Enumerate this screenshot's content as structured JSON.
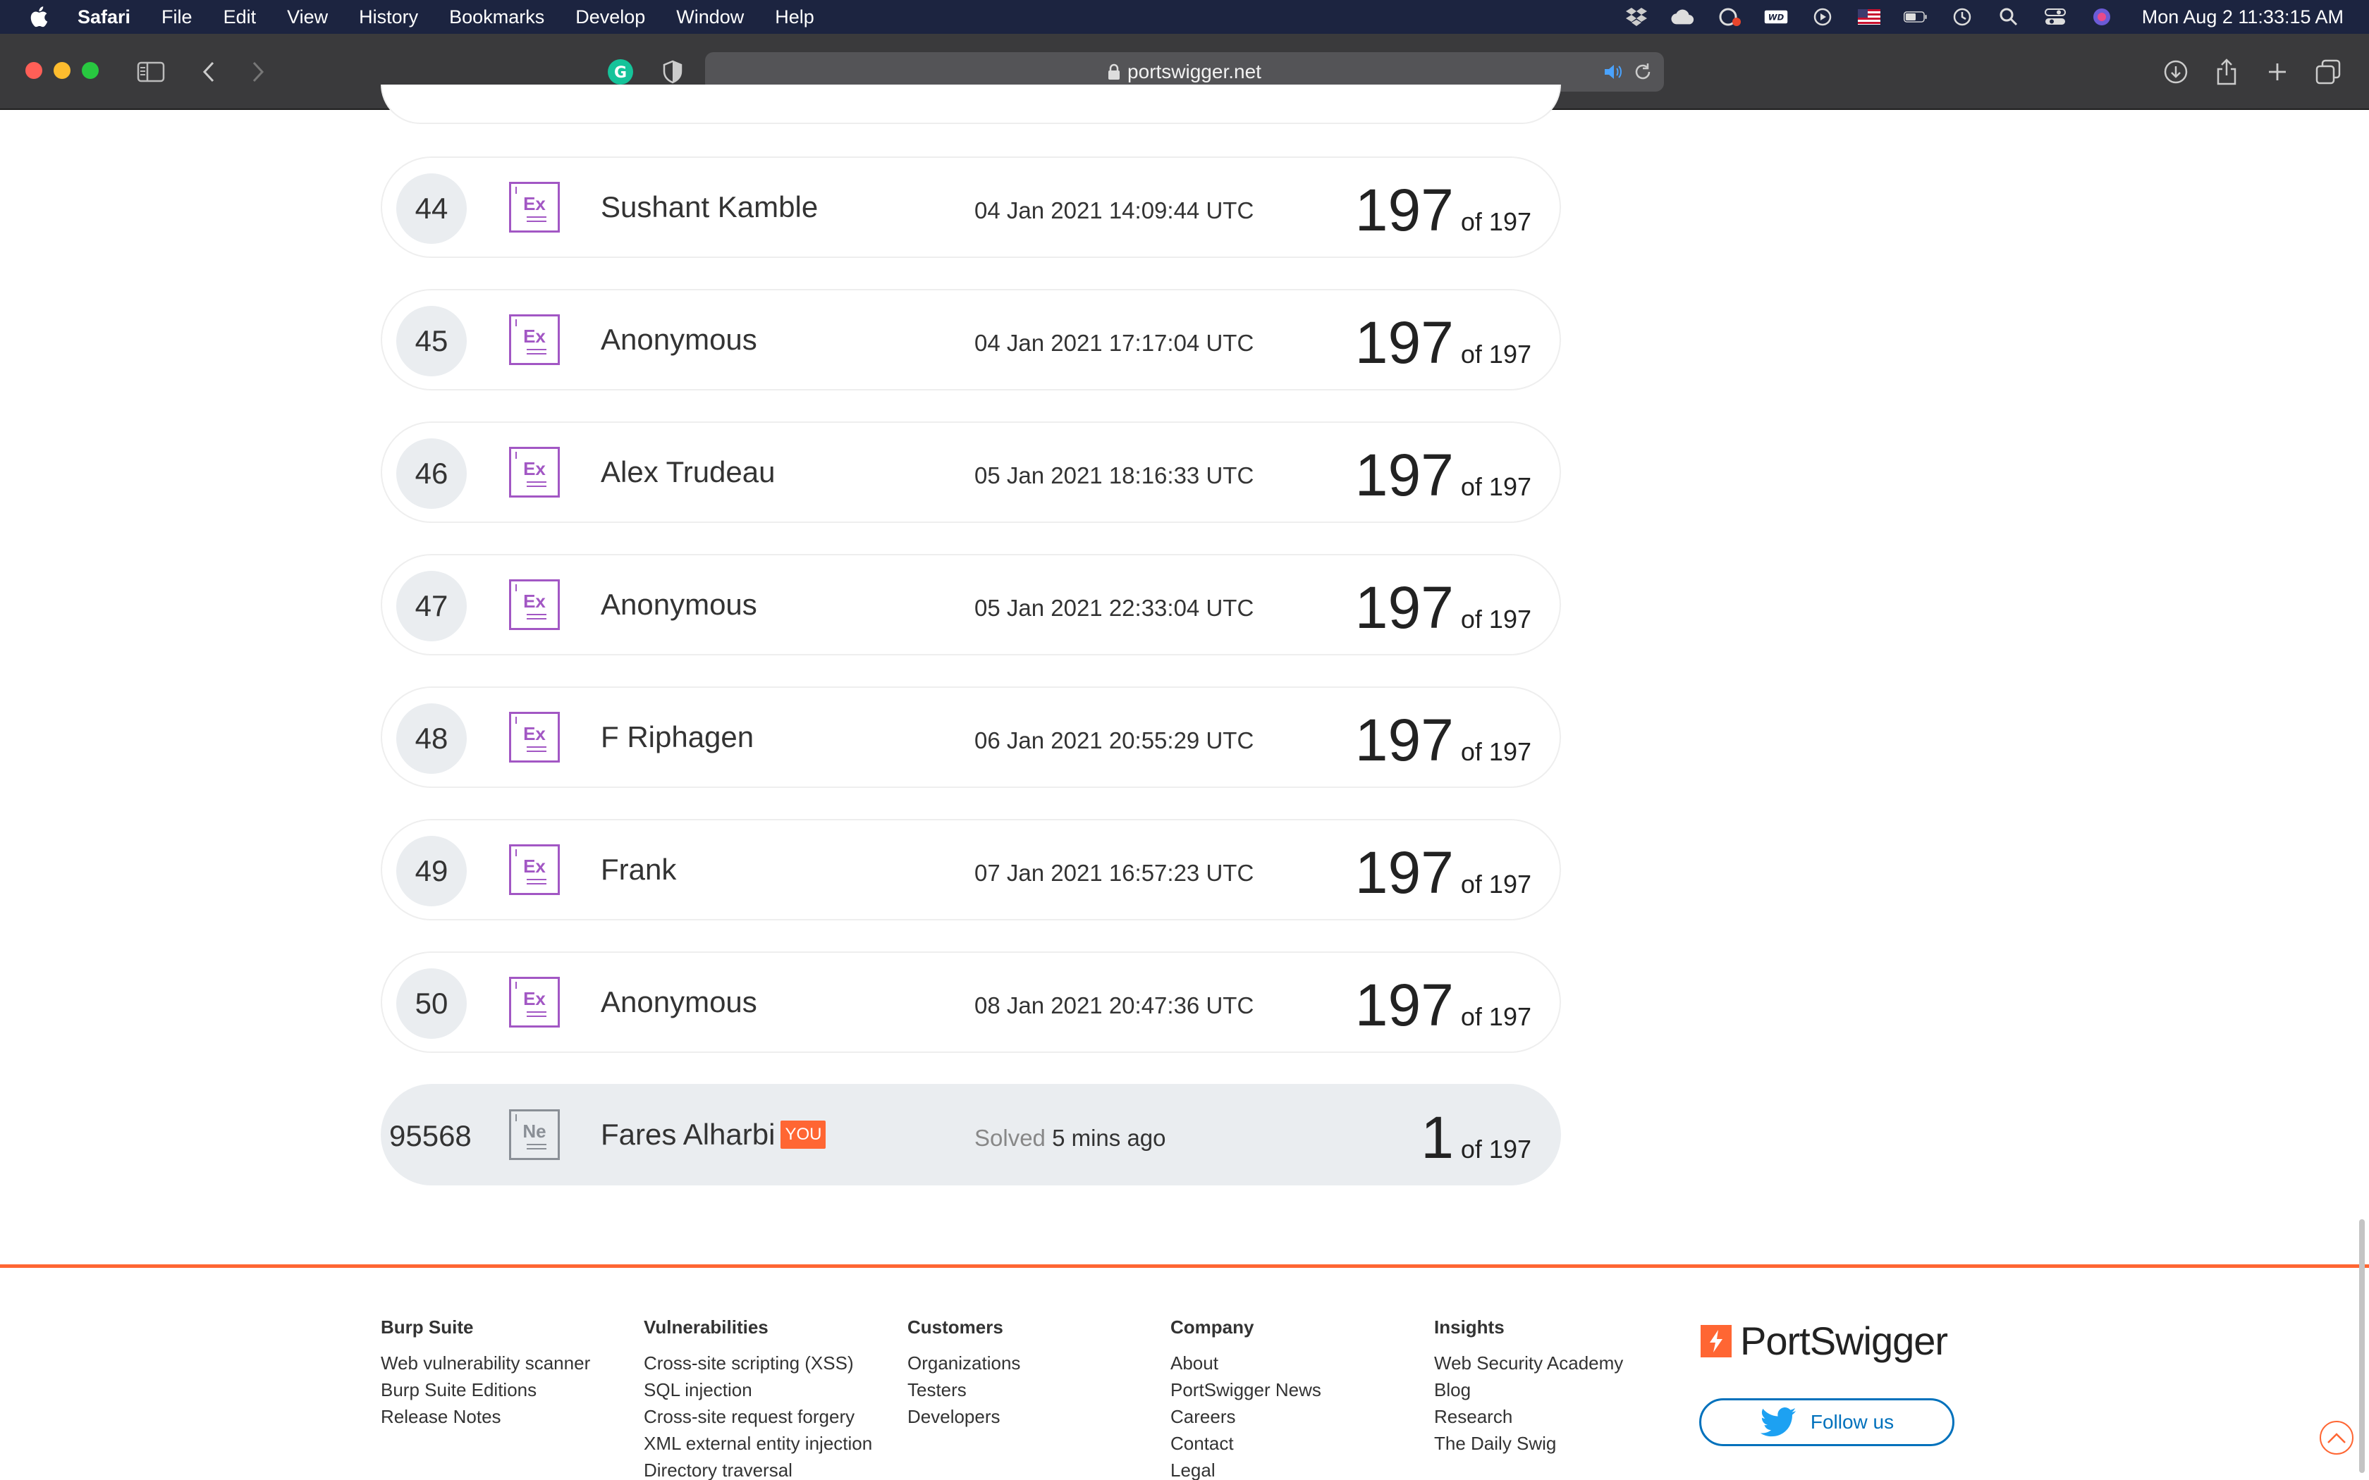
{
  "menubar": {
    "app": "Safari",
    "items": [
      "File",
      "Edit",
      "View",
      "History",
      "Bookmarks",
      "Develop",
      "Window",
      "Help"
    ],
    "clock": "Mon Aug 2  11:33:15 AM"
  },
  "toolbar": {
    "url": "portswigger.net"
  },
  "leaderboard": {
    "rows": [
      {
        "rank": "44",
        "badge": "Ex",
        "name": "Sushant Kamble",
        "date": "04 Jan 2021 14:09:44 UTC",
        "score": "197",
        "of": "of 197"
      },
      {
        "rank": "45",
        "badge": "Ex",
        "name": "Anonymous",
        "date": "04 Jan 2021 17:17:04 UTC",
        "score": "197",
        "of": "of 197"
      },
      {
        "rank": "46",
        "badge": "Ex",
        "name": "Alex Trudeau",
        "date": "05 Jan 2021 18:16:33 UTC",
        "score": "197",
        "of": "of 197"
      },
      {
        "rank": "47",
        "badge": "Ex",
        "name": "Anonymous",
        "date": "05 Jan 2021 22:33:04 UTC",
        "score": "197",
        "of": "of 197"
      },
      {
        "rank": "48",
        "badge": "Ex",
        "name": "F Riphagen",
        "date": "06 Jan 2021 20:55:29 UTC",
        "score": "197",
        "of": "of 197"
      },
      {
        "rank": "49",
        "badge": "Ex",
        "name": "Frank",
        "date": "07 Jan 2021 16:57:23 UTC",
        "score": "197",
        "of": "of 197"
      },
      {
        "rank": "50",
        "badge": "Ex",
        "name": "Anonymous",
        "date": "08 Jan 2021 20:47:36 UTC",
        "score": "197",
        "of": "of 197"
      }
    ],
    "you": {
      "rank": "95568",
      "badge": "Ne",
      "name": "Fares Alharbi",
      "tag": "YOU",
      "solved_label": "Solved",
      "solved_time": "5 mins ago",
      "score": "1",
      "of": "of 197"
    }
  },
  "footer": {
    "columns": [
      {
        "heading": "Burp Suite",
        "links": [
          "Web vulnerability scanner",
          "Burp Suite Editions",
          "Release Notes"
        ]
      },
      {
        "heading": "Vulnerabilities",
        "links": [
          "Cross-site scripting (XSS)",
          "SQL injection",
          "Cross-site request forgery",
          "XML external entity injection",
          "Directory traversal"
        ]
      },
      {
        "heading": "Customers",
        "links": [
          "Organizations",
          "Testers",
          "Developers"
        ]
      },
      {
        "heading": "Company",
        "links": [
          "About",
          "PortSwigger News",
          "Careers",
          "Contact",
          "Legal"
        ]
      },
      {
        "heading": "Insights",
        "links": [
          "Web Security Academy",
          "Blog",
          "Research",
          "The Daily Swig"
        ]
      }
    ],
    "brand": "PortSwigger",
    "follow_label": "Follow us"
  },
  "colors": {
    "accent": "#ff6633",
    "badge_expert": "#a257c4",
    "badge_newcomer": "#8a8f96",
    "twitter": "#0071bc"
  }
}
